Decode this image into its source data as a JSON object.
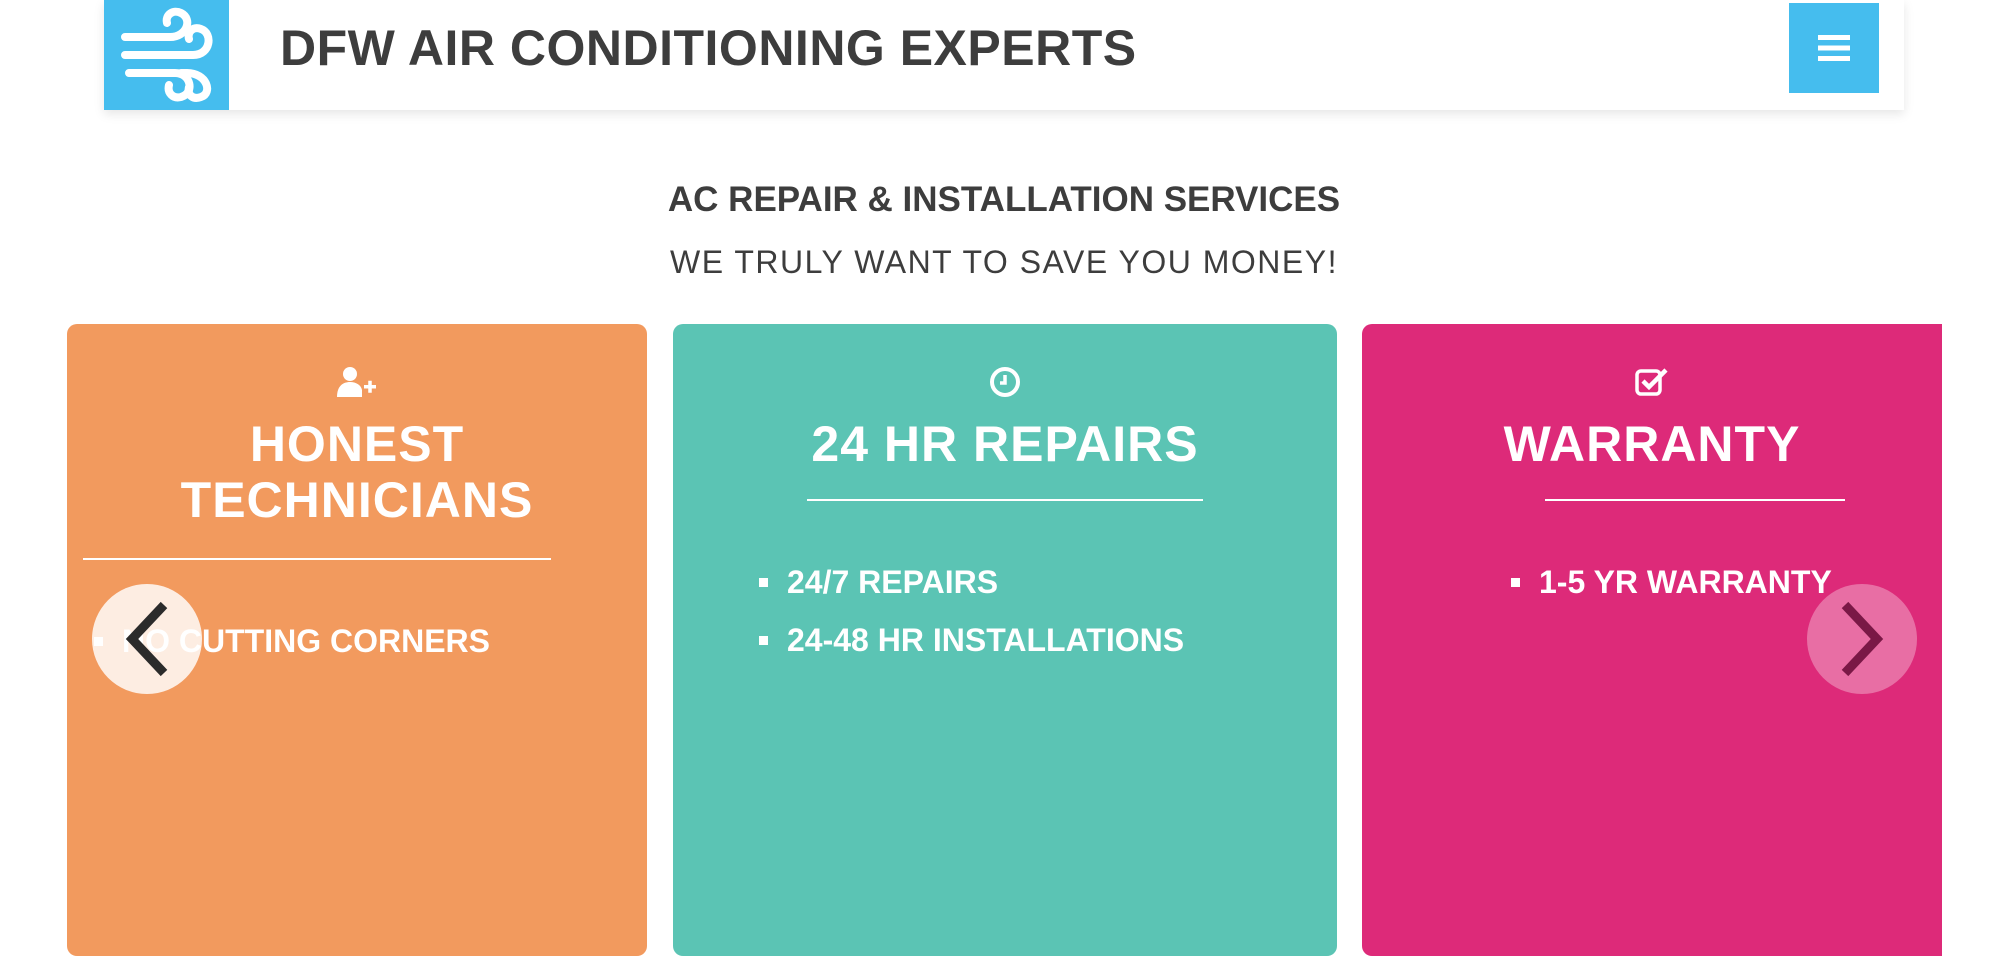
{
  "header": {
    "site_title": "DFW AIR CONDITIONING EXPERTS",
    "logo_icon": "wind-icon",
    "menu_icon": "hamburger-menu-icon",
    "brand_color": "#45bdee"
  },
  "intro": {
    "heading": "AC REPAIR & INSTALLATION SERVICES",
    "subheading": "WE TRULY WANT TO SAVE YOU MONEY!"
  },
  "cards": [
    {
      "icon": "user-plus-icon",
      "title_lines": [
        "HONEST",
        "TECHNICIANS"
      ],
      "color": "#f29a5e",
      "items": [
        "NO CUTTING CORNERS"
      ]
    },
    {
      "icon": "clock-icon",
      "title_lines": [
        "24 HR REPAIRS"
      ],
      "color": "#5bc4b4",
      "items": [
        "24/7 REPAIRS",
        "24-48 HR INSTALLATIONS"
      ]
    },
    {
      "icon": "check-square-icon",
      "title_lines": [
        "WARRANTY"
      ],
      "color": "#dd2a79",
      "items": [
        "1-5 YR WARRANTY"
      ]
    }
  ],
  "carousel": {
    "prev_icon": "chevron-left-icon",
    "next_icon": "chevron-right-icon"
  }
}
